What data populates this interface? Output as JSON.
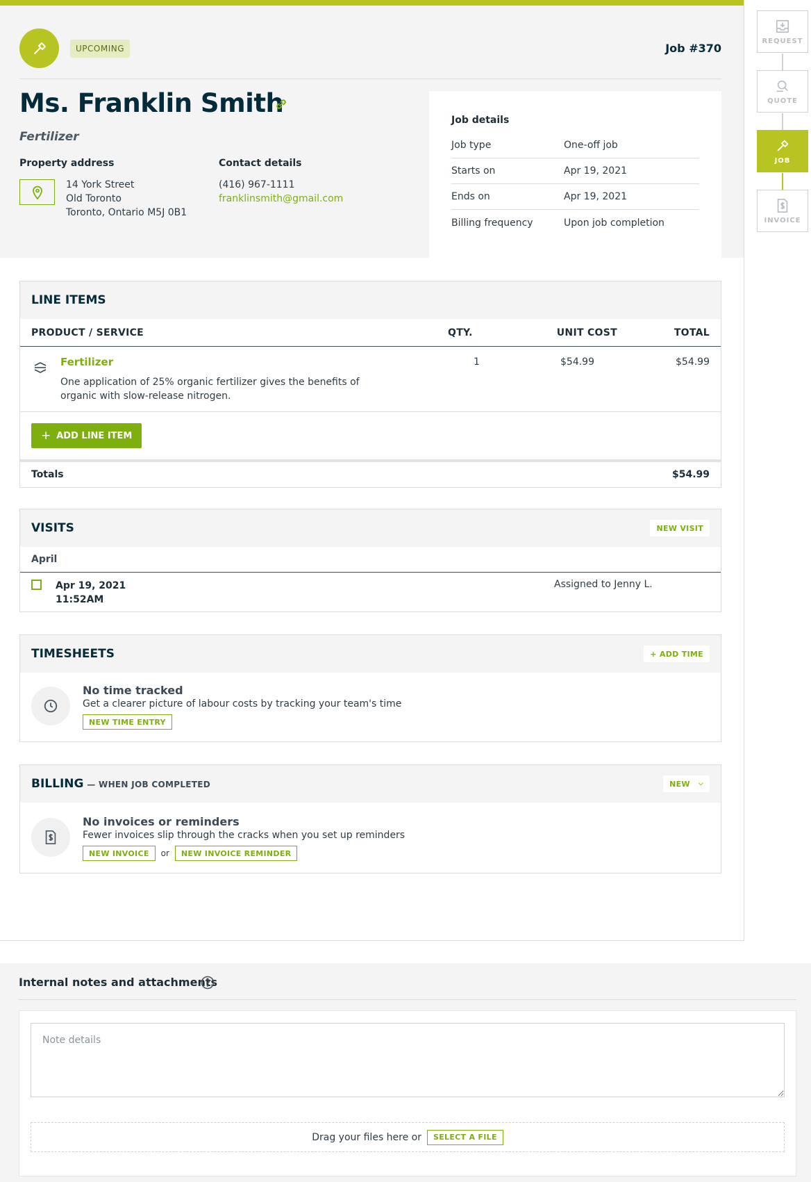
{
  "header": {
    "status": "UPCOMING",
    "job_number": "Job #370",
    "client_name": "Ms. Franklin Smith",
    "job_title": "Fertilizer",
    "property_label": "Property address",
    "address_lines": [
      "14 York Street",
      "Old Toronto",
      "Toronto, Ontario M5J 0B1"
    ],
    "contact_label": "Contact details",
    "phone": "(416) 967-1111",
    "email": "franklinsmith@gmail.com"
  },
  "job_details": {
    "title": "Job details",
    "rows": [
      {
        "label": "Job type",
        "value": "One-off job"
      },
      {
        "label": "Starts on",
        "value": "Apr 19, 2021"
      },
      {
        "label": "Ends on",
        "value": "Apr 19, 2021"
      },
      {
        "label": "Billing frequency",
        "value": "Upon job completion"
      }
    ]
  },
  "workflow": {
    "steps": [
      {
        "label": "REQUEST",
        "icon": "inbox-icon"
      },
      {
        "label": "QUOTE",
        "icon": "magnify-icon"
      },
      {
        "label": "JOB",
        "icon": "hammer-icon",
        "active": true
      },
      {
        "label": "INVOICE",
        "icon": "invoice-icon"
      }
    ]
  },
  "line_items": {
    "title": "LINE ITEMS",
    "columns": {
      "product": "PRODUCT / SERVICE",
      "qty": "QTY.",
      "unit_cost": "UNIT COST",
      "total": "TOTAL"
    },
    "items": [
      {
        "name": "Fertilizer",
        "description_lines": [
          "One application of 25% organic fertilizer gives the benefits of",
          "organic with slow-release nitrogen."
        ],
        "qty": "1",
        "unit_cost": "$54.99",
        "total": "$54.99"
      }
    ],
    "add_label": "ADD LINE ITEM",
    "totals_label": "Totals",
    "totals_value": "$54.99"
  },
  "visits": {
    "title": "VISITS",
    "new_label": "NEW VISIT",
    "month": "April",
    "items": [
      {
        "date": "Apr 19, 2021",
        "time": "11:52AM",
        "assigned": "Assigned to Jenny L."
      }
    ]
  },
  "timesheets": {
    "title": "TIMESHEETS",
    "add_label": "+ ADD TIME",
    "empty_title": "No time tracked",
    "empty_text": "Get a clearer picture of labour costs by tracking your team's time",
    "action_label": "NEW TIME ENTRY"
  },
  "billing": {
    "title": "BILLING",
    "subtitle": "— WHEN JOB COMPLETED",
    "new_label": "NEW",
    "empty_title": "No invoices or reminders",
    "empty_text": "Fewer invoices slip through the cracks when you set up reminders",
    "invoice_label": "NEW INVOICE",
    "or_label": "or",
    "reminder_label": "NEW INVOICE REMINDER"
  },
  "notes": {
    "title": "Internal notes and attachments",
    "placeholder": "Note details",
    "drop_text": "Drag your files here or",
    "select_label": "SELECT A FILE"
  },
  "colors": {
    "accent": "#b8c422",
    "green": "#7db00e",
    "navy": "#032b3a"
  }
}
